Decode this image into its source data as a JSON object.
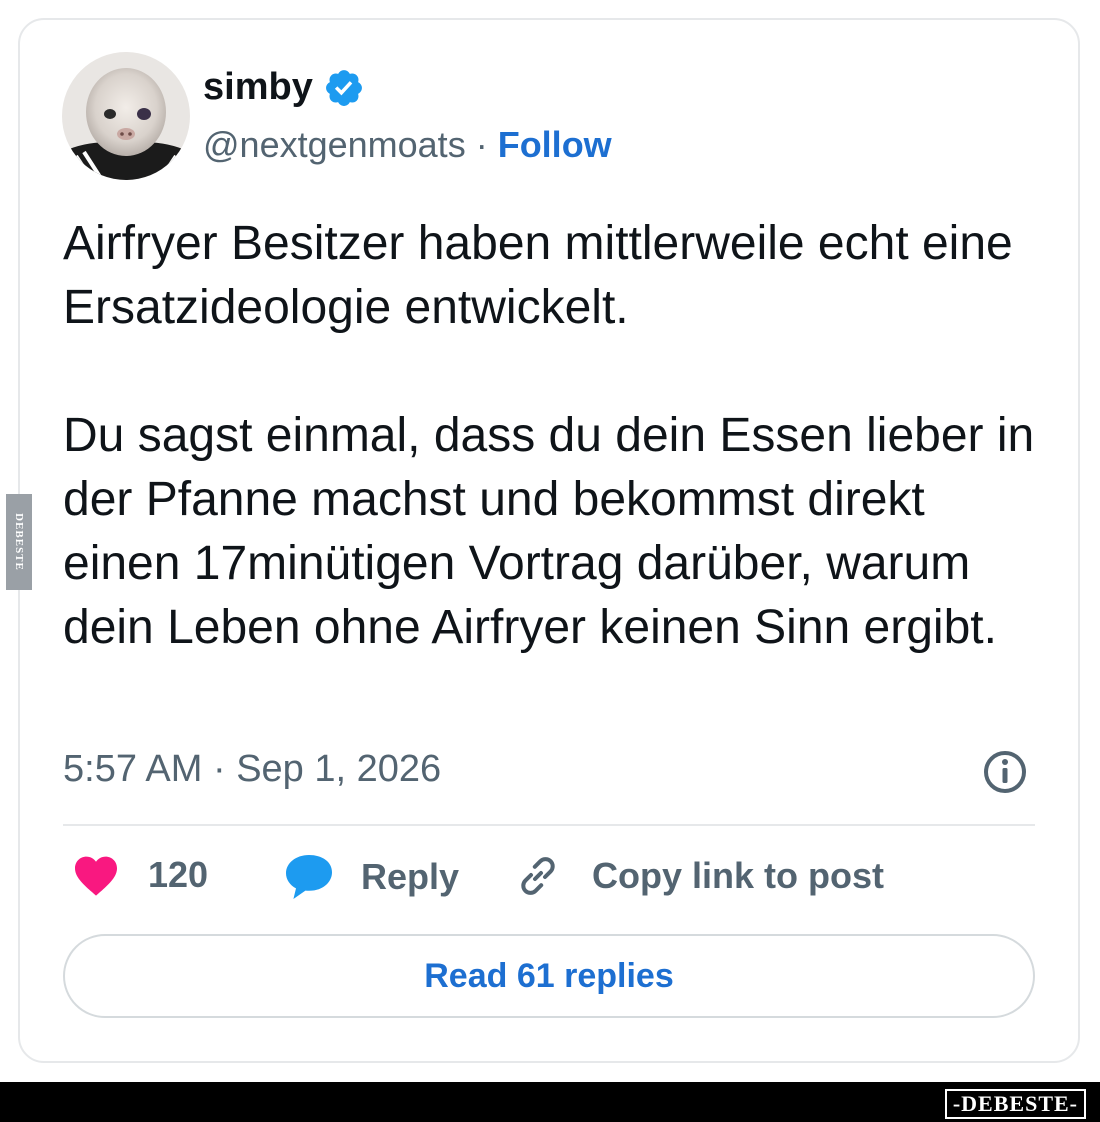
{
  "user": {
    "name": "simby",
    "handle": "@nextgenmoats",
    "separator": "·",
    "follow_label": "Follow"
  },
  "tweet": {
    "paragraph_1": "Airfryer Besitzer haben mittlerweile echt eine Ersatzideologie entwickelt.",
    "paragraph_2": "Du sagst einmal, dass du dein Essen lieber in der Pfanne machst und bekommst direkt einen 17minütigen Vortrag darüber, warum dein Leben ohne Airfryer keinen Sinn ergibt.",
    "timestamp": "5:57 AM · Sep 1, 2026"
  },
  "actions": {
    "like_count": "120",
    "reply_label": "Reply",
    "copy_link_label": "Copy link to post"
  },
  "read_replies_label": "Read 61 replies",
  "watermark": {
    "side_text": "DEBESTE",
    "footer_text": "-DEBESTE-"
  },
  "colors": {
    "like": "#f91880",
    "reply": "#1d9bf0",
    "link": "#1d6fd1",
    "verified": "#1d9bf0"
  },
  "icons": [
    "verified-badge-icon",
    "info-icon",
    "heart-icon",
    "speech-bubble-icon",
    "link-icon"
  ]
}
